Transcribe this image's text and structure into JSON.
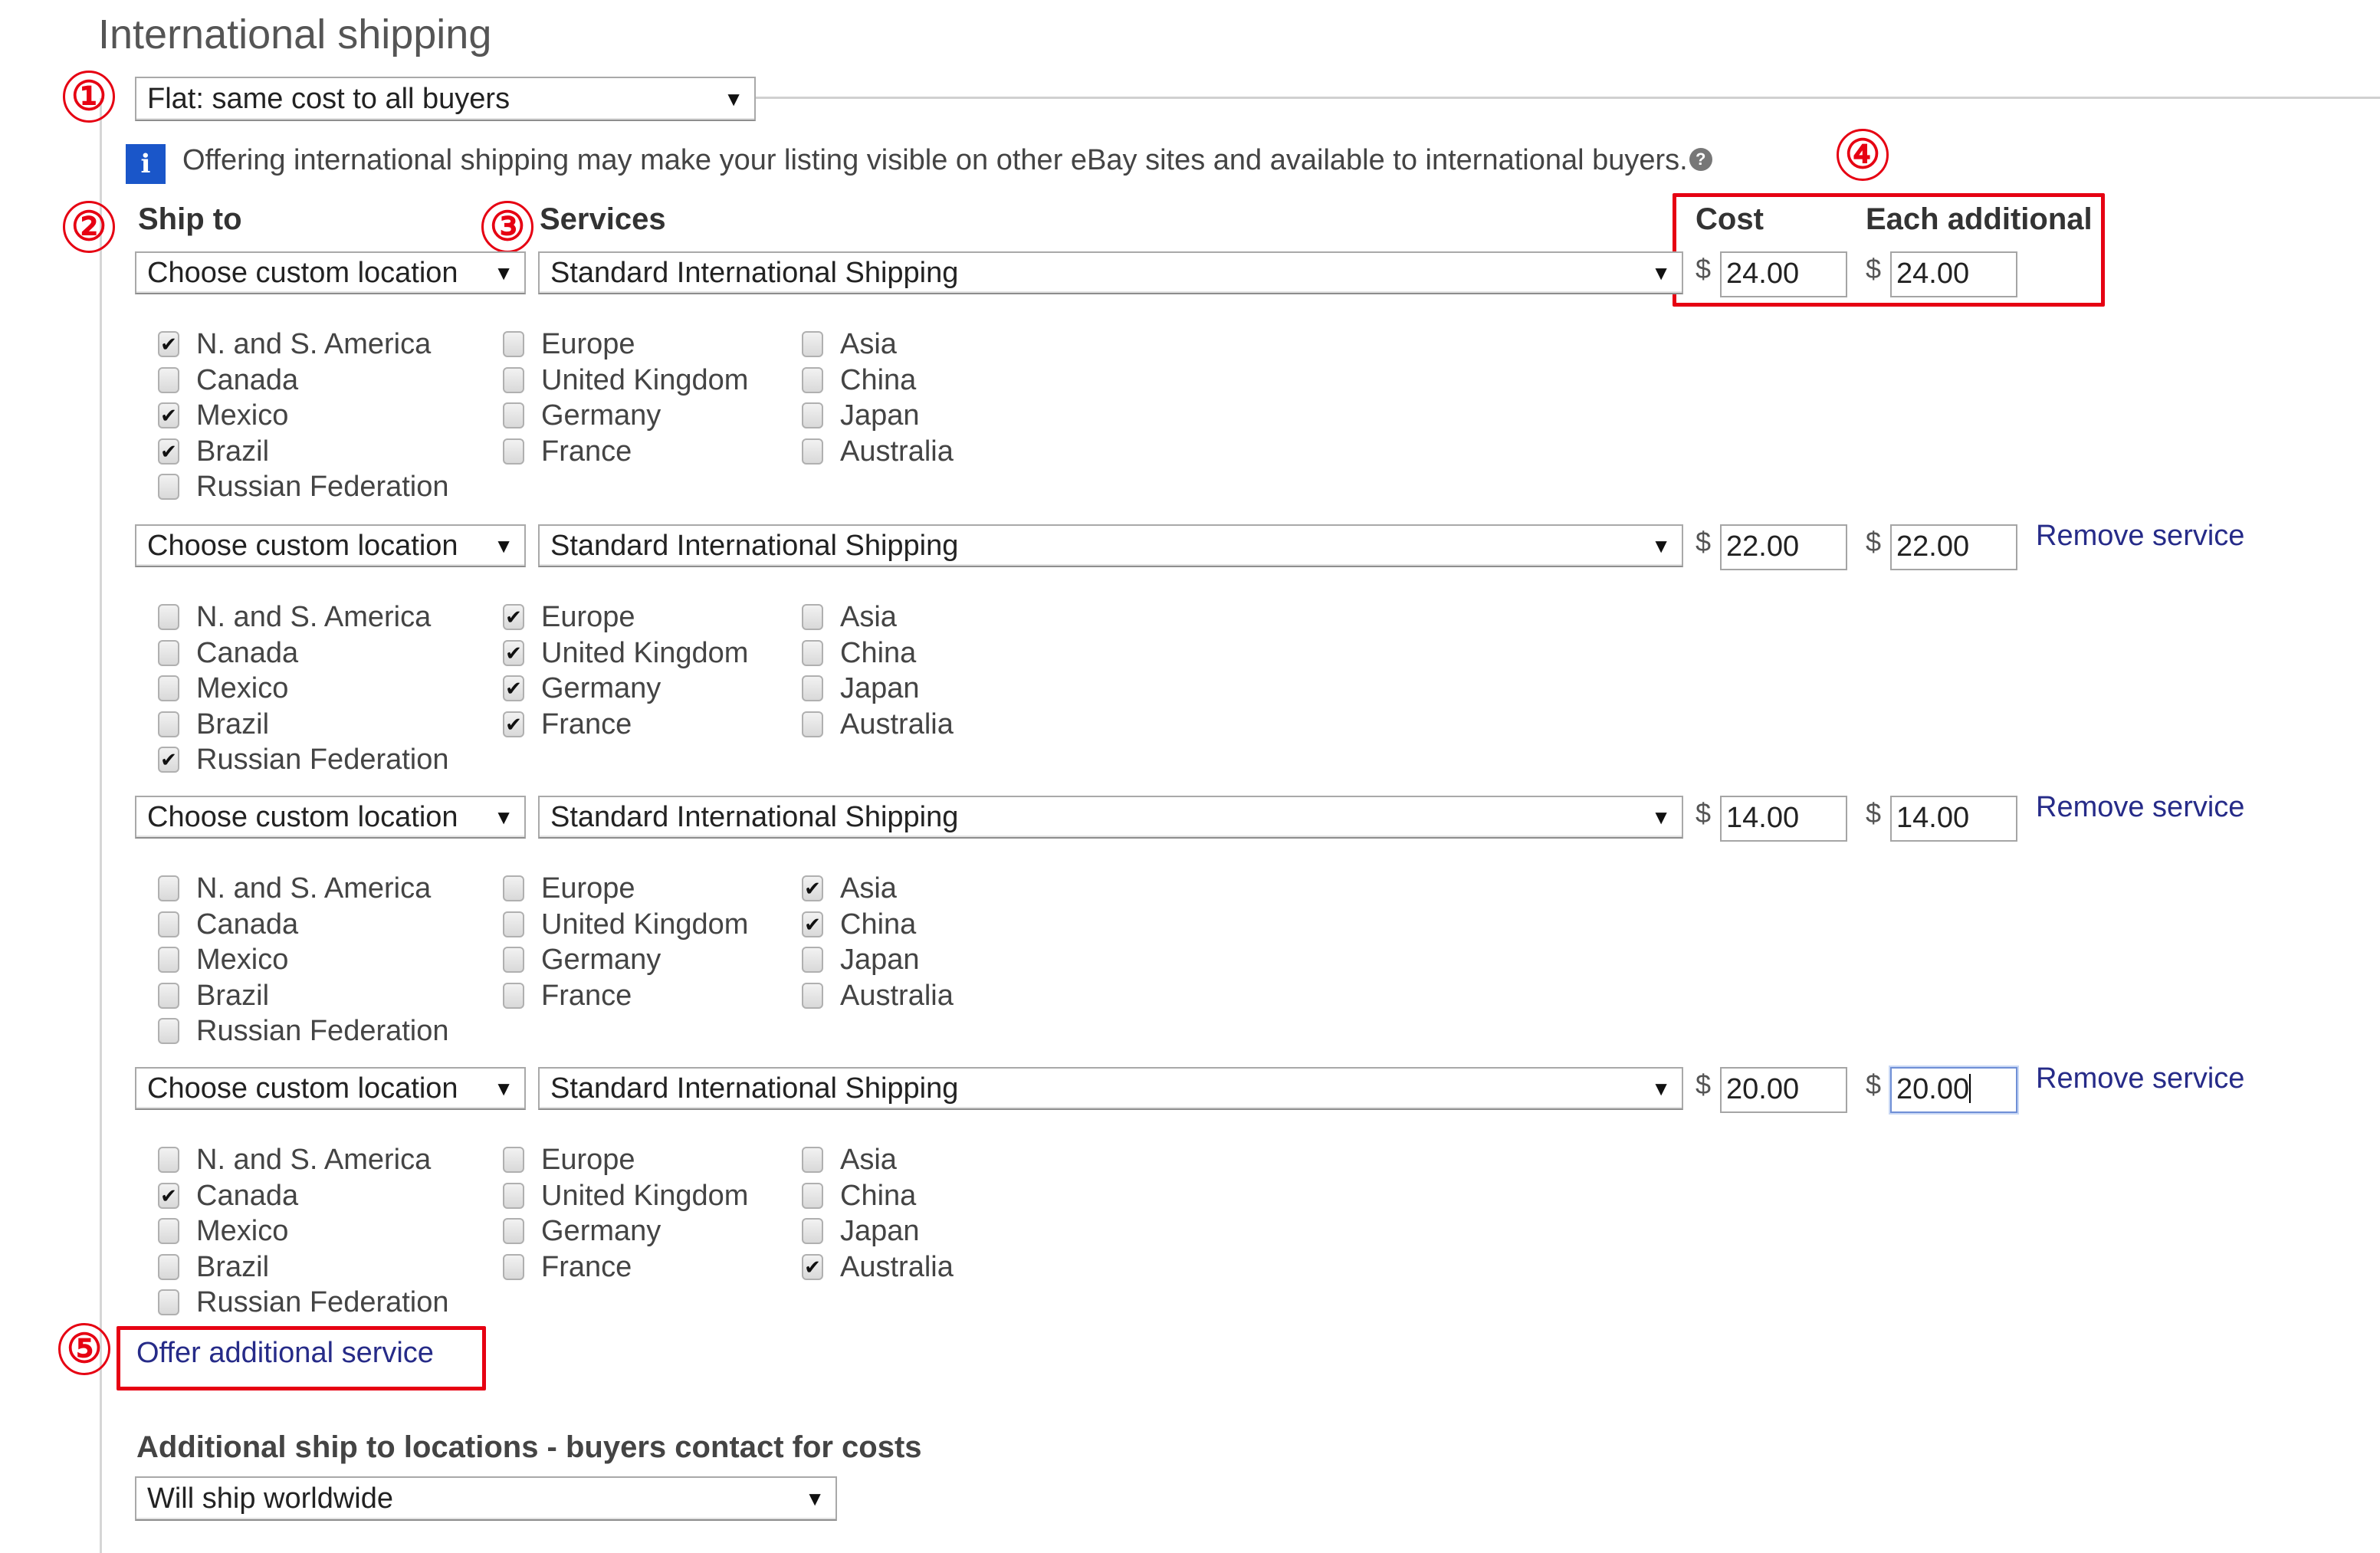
{
  "section_title": "International shipping",
  "shipping_type_select": {
    "value": "Flat: same cost to all buyers"
  },
  "info": {
    "icon": "info-icon",
    "text": "Offering international shipping may make your listing visible on other eBay sites and available to international buyers.",
    "help_icon": "?"
  },
  "annotations": [
    "①",
    "②",
    "③",
    "④",
    "⑤"
  ],
  "headers": {
    "ship_to": "Ship to",
    "services": "Services",
    "cost": "Cost",
    "each_additional": "Each additional"
  },
  "currency_symbol": "$",
  "location_columns": [
    [
      "N. and S. America",
      "Canada",
      "Mexico",
      "Brazil",
      "Russian Federation"
    ],
    [
      "Europe",
      "United Kingdom",
      "Germany",
      "France"
    ],
    [
      "Asia",
      "China",
      "Japan",
      "Australia"
    ]
  ],
  "services": [
    {
      "ship_to": "Choose custom location",
      "service": "Standard International Shipping",
      "cost": "24.00",
      "each_additional": "24.00",
      "remove_label": "",
      "checked": {
        "N. and S. America": true,
        "Canada": false,
        "Mexico": true,
        "Brazil": true,
        "Russian Federation": false,
        "Europe": false,
        "United Kingdom": false,
        "Germany": false,
        "France": false,
        "Asia": false,
        "China": false,
        "Japan": false,
        "Australia": false
      }
    },
    {
      "ship_to": "Choose custom location",
      "service": "Standard International Shipping",
      "cost": "22.00",
      "each_additional": "22.00",
      "remove_label": "Remove service",
      "checked": {
        "N. and S. America": false,
        "Canada": false,
        "Mexico": false,
        "Brazil": false,
        "Russian Federation": true,
        "Europe": true,
        "United Kingdom": true,
        "Germany": true,
        "France": true,
        "Asia": false,
        "China": false,
        "Japan": false,
        "Australia": false
      }
    },
    {
      "ship_to": "Choose custom location",
      "service": "Standard International Shipping",
      "cost": "14.00",
      "each_additional": "14.00",
      "remove_label": "Remove service",
      "checked": {
        "N. and S. America": false,
        "Canada": false,
        "Mexico": false,
        "Brazil": false,
        "Russian Federation": false,
        "Europe": false,
        "United Kingdom": false,
        "Germany": false,
        "France": false,
        "Asia": true,
        "China": true,
        "Japan": false,
        "Australia": false
      }
    },
    {
      "ship_to": "Choose custom location",
      "service": "Standard International Shipping",
      "cost": "20.00",
      "each_additional": "20.00",
      "each_additional_focused": true,
      "remove_label": "Remove service",
      "checked": {
        "N. and S. America": false,
        "Canada": true,
        "Mexico": false,
        "Brazil": false,
        "Russian Federation": false,
        "Europe": false,
        "United Kingdom": false,
        "Germany": false,
        "France": false,
        "Asia": false,
        "China": false,
        "Japan": false,
        "Australia": true
      }
    }
  ],
  "offer_additional_service": "Offer additional service",
  "additional_locations": {
    "heading": "Additional ship to locations - buyers contact for costs",
    "select_value": "Will ship worldwide"
  },
  "colors": {
    "annotation_red": "#e60012",
    "link_blue": "#262b88",
    "info_blue": "#1a56c9"
  }
}
